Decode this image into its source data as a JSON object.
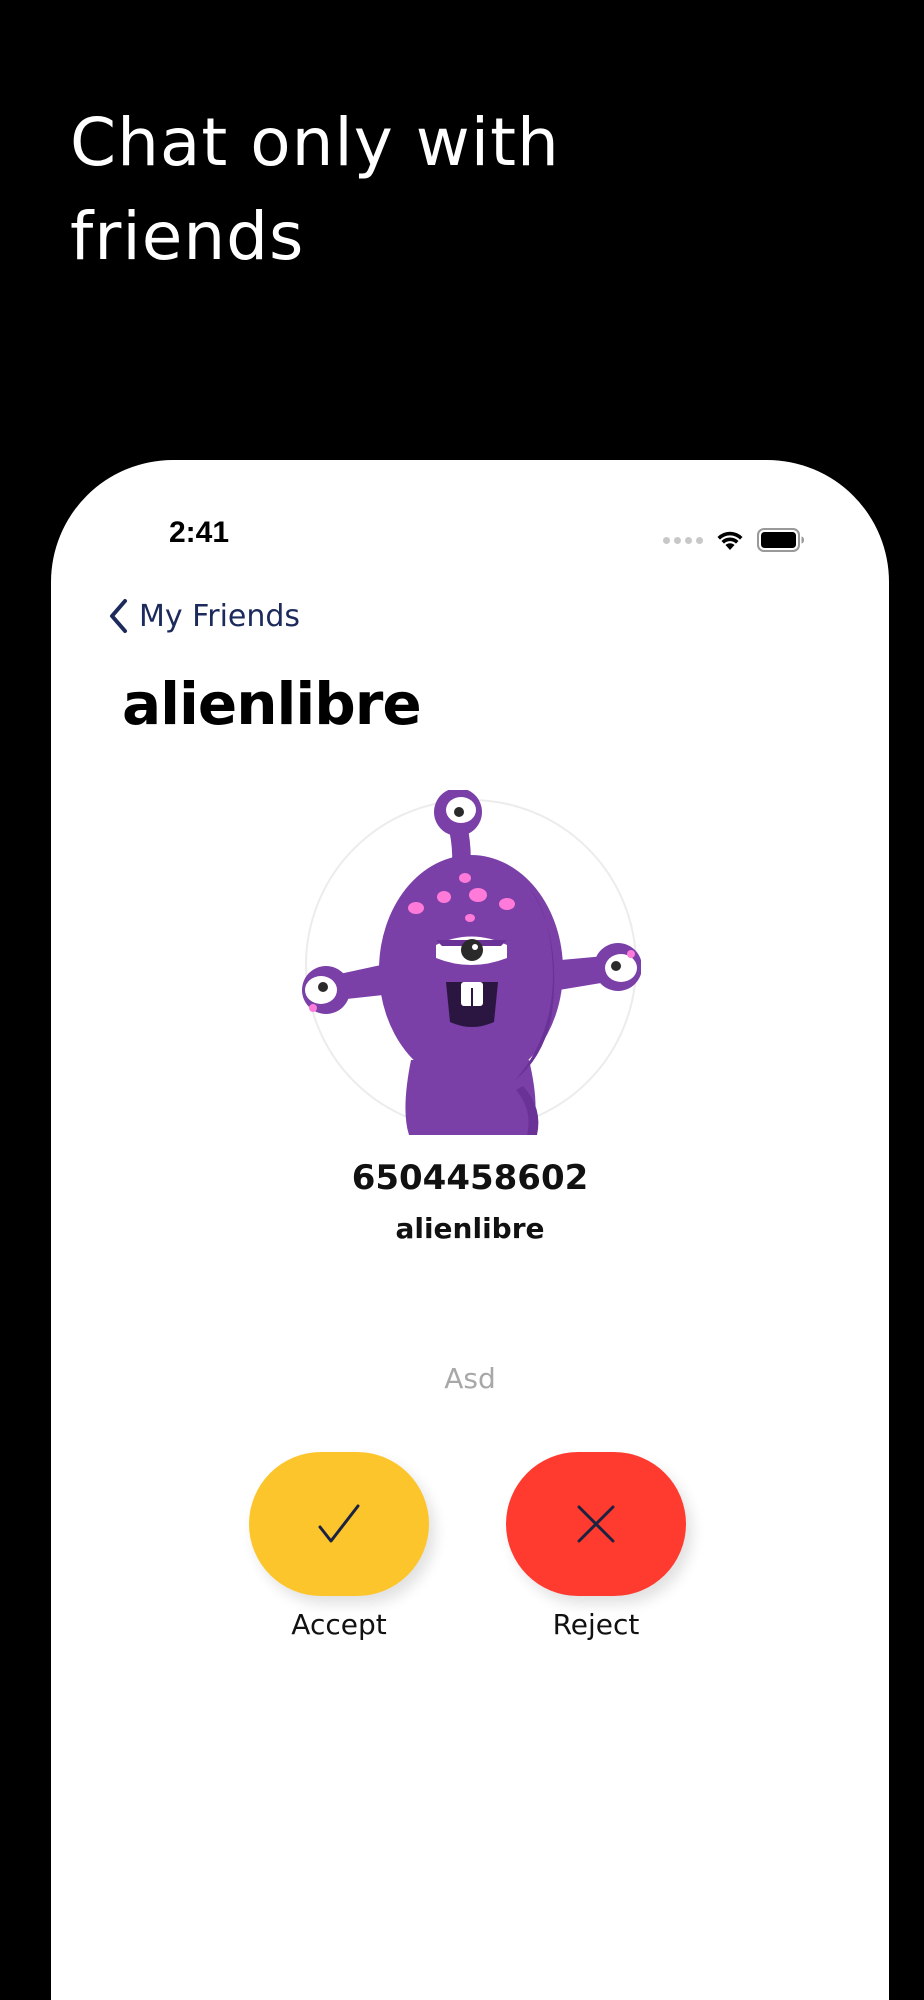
{
  "promo": {
    "headline": "Chat only with friends"
  },
  "status_bar": {
    "time": "2:41"
  },
  "nav": {
    "back_label": "My Friends"
  },
  "profile": {
    "title": "alienlibre",
    "phone": "6504458602",
    "username": "alienlibre",
    "message": "Asd"
  },
  "actions": {
    "accept_label": "Accept",
    "reject_label": "Reject"
  },
  "colors": {
    "accept": "#fcc52b",
    "reject": "#ff3b30",
    "avatar_purple": "#7b3fa8",
    "nav_text": "#1d2a5c"
  },
  "icons": {
    "back": "chevron-left-icon",
    "accept": "checkmark-icon",
    "reject": "close-icon",
    "wifi": "wifi-icon",
    "battery": "battery-icon"
  }
}
